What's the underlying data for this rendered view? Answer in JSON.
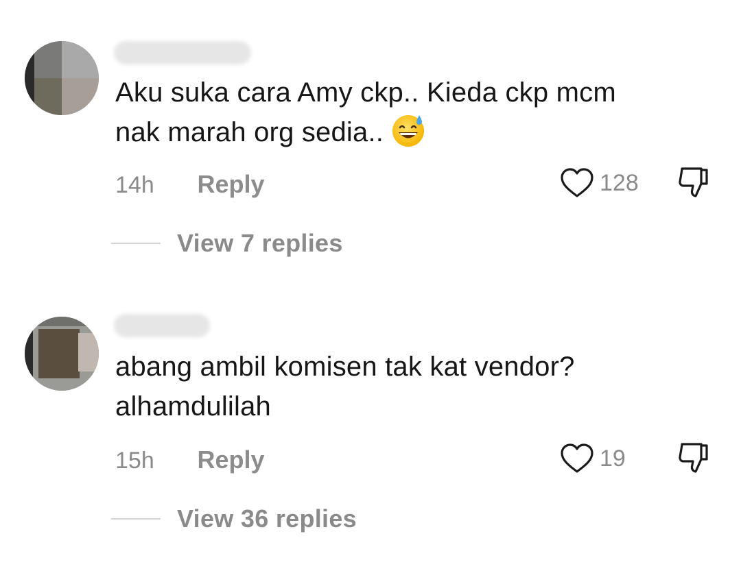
{
  "comments": [
    {
      "text_line1": "Aku suka cara Amy ckp.. Kieda ckp mcm",
      "text_line2": "nak marah org sedia..",
      "emoji": "grinning-face-with-sweat",
      "time": "14h",
      "reply_label": "Reply",
      "like_count": "128",
      "view_replies": "View 7 replies"
    },
    {
      "text_line1": "abang ambil komisen tak kat vendor?",
      "text_line2": "alhamdulilah",
      "time": "15h",
      "reply_label": "Reply",
      "like_count": "19",
      "view_replies": "View 36 replies"
    }
  ],
  "icons": {
    "like": "heart-outline-icon",
    "dislike": "thumbs-down-outline-icon"
  },
  "colors": {
    "text": "#161616",
    "muted": "#8a8a8a",
    "background": "#ffffff"
  }
}
